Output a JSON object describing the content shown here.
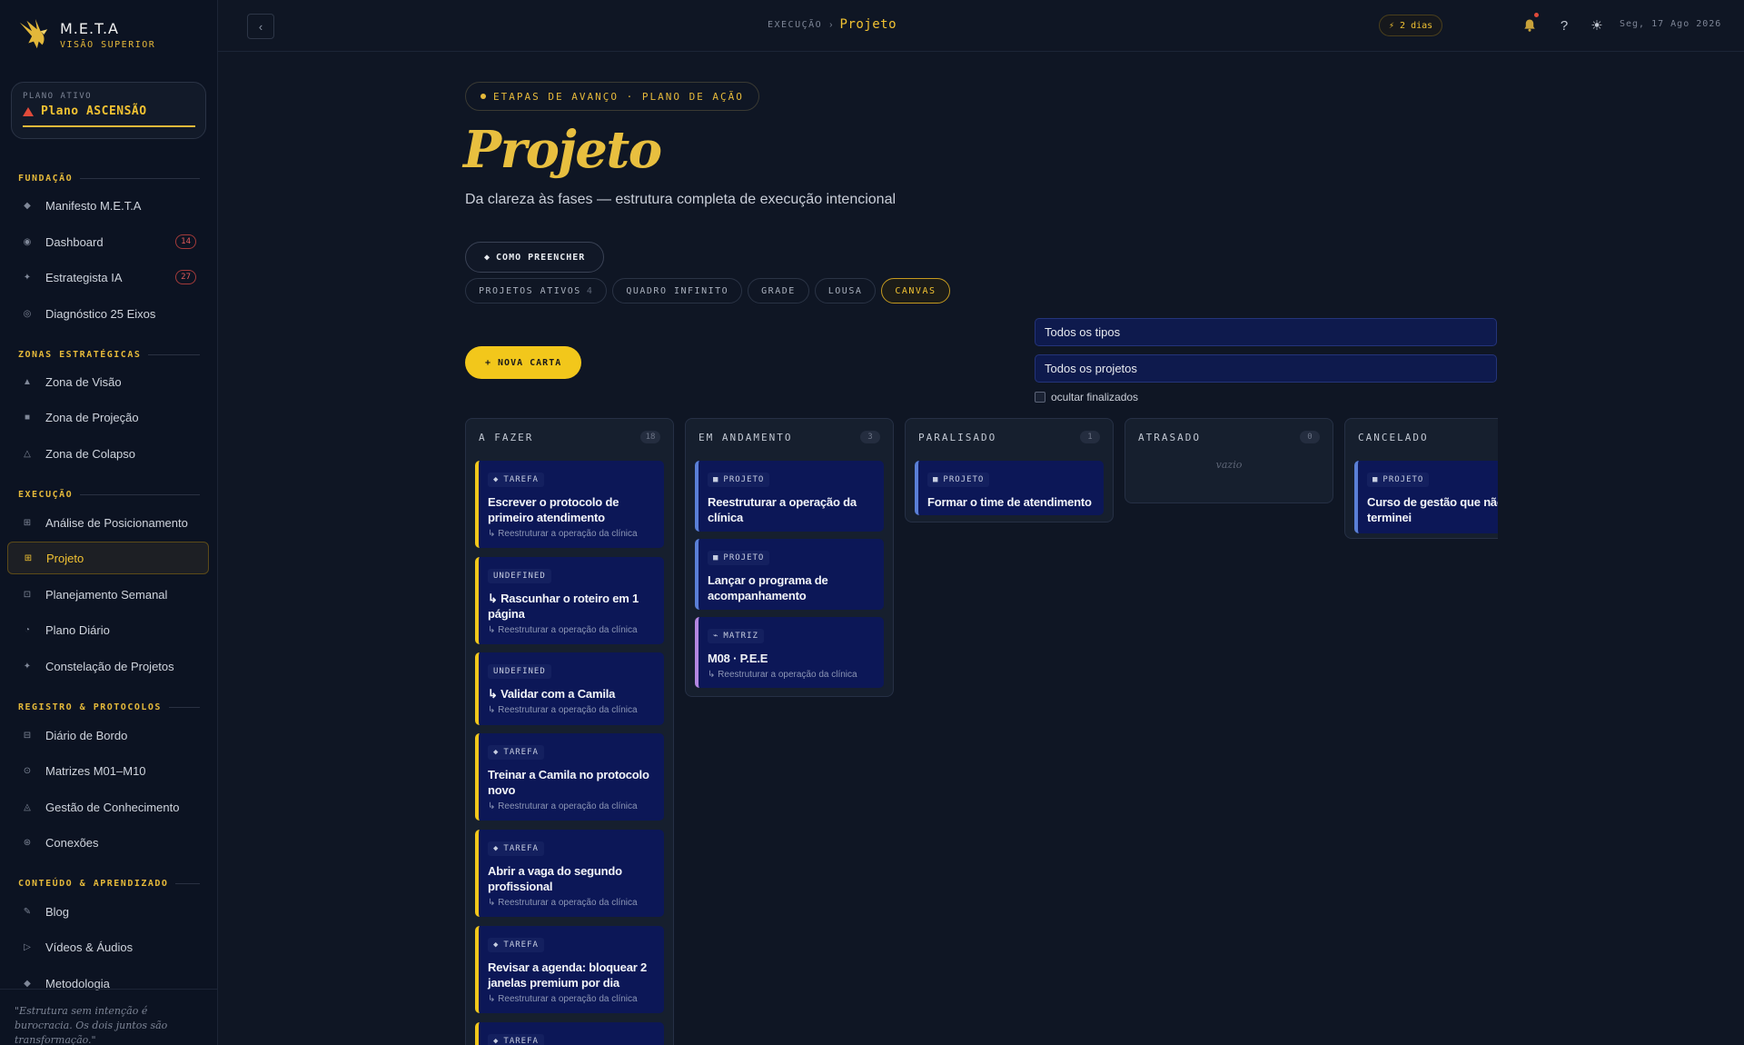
{
  "brand": {
    "name": "M.E.T.A",
    "subtitle": "VISÃO SUPERIOR"
  },
  "plan": {
    "label": "PLANO ATIVO",
    "name": "Plano ASCENSÃO"
  },
  "sidebar": {
    "sections": [
      {
        "title": "FUNDAÇÃO"
      },
      {
        "title": "ZONAS ESTRATÉGICAS"
      },
      {
        "title": "EXECUÇÃO"
      },
      {
        "title": "REGISTRO & PROTOCOLOS"
      },
      {
        "title": "CONTEÚDO & APRENDIZADO"
      }
    ],
    "items": [
      {
        "label": "Manifesto M.E.T.A",
        "icon": "diamond-icon"
      },
      {
        "label": "Dashboard",
        "icon": "circle-icon",
        "badge": "14"
      },
      {
        "label": "Estrategista IA",
        "icon": "sparkle-icon",
        "badge": "27"
      },
      {
        "label": "Diagnóstico 25 Eixos",
        "icon": "ring-icon"
      },
      {
        "label": "Zona de Visão",
        "icon": "triangle-icon"
      },
      {
        "label": "Zona de Projeção",
        "icon": "square-icon"
      },
      {
        "label": "Zona de Colapso",
        "icon": "triangle-outline-icon"
      },
      {
        "label": "Análise de Posicionamento",
        "icon": "grid-icon"
      },
      {
        "label": "Projeto",
        "icon": "grid-active-icon"
      },
      {
        "label": "Planejamento Semanal",
        "icon": "calendar-icon"
      },
      {
        "label": "Plano Diário",
        "icon": "clock-icon"
      },
      {
        "label": "Constelação de Projetos",
        "icon": "star-icon"
      },
      {
        "label": "Diário de Bordo",
        "icon": "book-icon"
      },
      {
        "label": "Matrizes M01–M10",
        "icon": "target-icon"
      },
      {
        "label": "Gestão de Conhecimento",
        "icon": "triangle-outline-icon"
      },
      {
        "label": "Conexões",
        "icon": "node-icon"
      },
      {
        "label": "Blog",
        "icon": "pencil-icon"
      },
      {
        "label": "Vídeos & Áudios",
        "icon": "play-icon"
      },
      {
        "label": "Metodologia",
        "icon": "diamond-icon"
      }
    ],
    "quote": "\"Estrutura sem intenção é burocracia. Os dois juntos são transformação.\""
  },
  "topbar": {
    "breadcrumb_parent": "EXECUÇÃO",
    "breadcrumb_current": "Projeto",
    "streak": "⚡ 2 dias",
    "date": "Seg, 17 Ago 2026"
  },
  "main": {
    "eyebrow": "ETAPAS DE AVANÇO · PLANO DE AÇÃO",
    "title": "Projeto",
    "subtitle": "Da clareza às fases — estrutura completa de execução intencional",
    "howto_label": "COMO PREENCHER",
    "views": [
      {
        "label": "PROJETOS ATIVOS",
        "count": "4"
      },
      {
        "label": "QUADRO INFINITO"
      },
      {
        "label": "GRADE"
      },
      {
        "label": "LOUSA"
      },
      {
        "label": "CANVAS",
        "active": true
      }
    ],
    "filter_types": "Todos os tipos",
    "filter_projects": "Todos os projetos",
    "new_card_label": "+ NOVA CARTA",
    "hide_done_label": "ocultar finalizados"
  },
  "board": {
    "columns": [
      {
        "title": "A FAZER",
        "count": "18"
      },
      {
        "title": "EM ANDAMENTO",
        "count": "3"
      },
      {
        "title": "PARALISADO",
        "count": "1"
      },
      {
        "title": "ATRASADO",
        "count": "0",
        "empty": "vazio"
      },
      {
        "title": "CANCELADO",
        "count": ""
      }
    ],
    "todo": [
      {
        "tag": "TAREFA",
        "title": "Escrever o protocolo de primeiro atendimento",
        "parent": "↳ Reestruturar a operação da clínica"
      },
      {
        "tag": "UNDEFINED",
        "title": "↳ Rascunhar o roteiro em 1 página",
        "parent": "↳ Reestruturar a operação da clínica"
      },
      {
        "tag": "UNDEFINED",
        "title": "↳ Validar com a Camila",
        "parent": "↳ Reestruturar a operação da clínica"
      },
      {
        "tag": "TAREFA",
        "title": "Treinar a Camila no protocolo novo",
        "parent": "↳ Reestruturar a operação da clínica"
      },
      {
        "tag": "TAREFA",
        "title": "Abrir a vaga do segundo profissional",
        "parent": "↳ Reestruturar a operação da clínica"
      },
      {
        "tag": "TAREFA",
        "title": "Revisar a agenda: bloquear 2 janelas premium por dia",
        "parent": "↳ Reestruturar a operação da clínica"
      },
      {
        "tag": "TAREFA"
      }
    ],
    "doing": [
      {
        "tag": "PROJETO",
        "title": "Reestruturar a operação da clínica"
      },
      {
        "tag": "PROJETO",
        "title": "Lançar o programa de acompanhamento"
      },
      {
        "tag": "MATRIZ",
        "title": "M08 · P.E.E",
        "parent": "↳ Reestruturar a operação da clínica"
      }
    ],
    "paused": [
      {
        "tag": "PROJETO",
        "title": "Formar o time de atendimento"
      }
    ],
    "cancelled": [
      {
        "tag": "PROJETO",
        "title": "Curso de gestão que não terminei"
      }
    ]
  }
}
